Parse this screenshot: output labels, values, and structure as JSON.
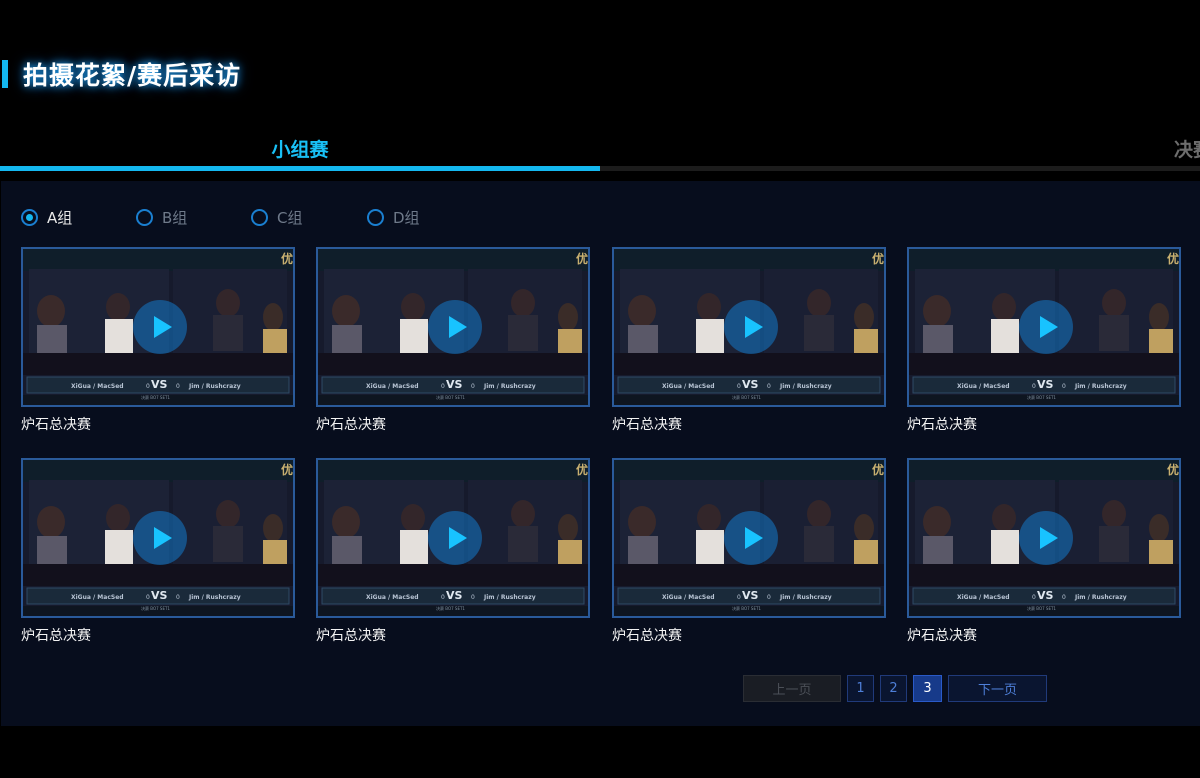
{
  "section": {
    "title": "拍摄花絮/赛后采访"
  },
  "tabs": [
    {
      "label": "小组赛",
      "active": true
    },
    {
      "label": "决赛",
      "active": false
    }
  ],
  "groups": [
    {
      "label": "A组",
      "selected": true
    },
    {
      "label": "B组",
      "selected": false
    },
    {
      "label": "C组",
      "selected": false
    },
    {
      "label": "D组",
      "selected": false
    }
  ],
  "videos": [
    {
      "title": "炉石总决赛",
      "team_left": "XiGua / MacSed",
      "team_right": "Jim / Rushcrazy",
      "score_left": "0",
      "score_right": "0",
      "vs": "VS",
      "stage": "决赛 BO7 SET1"
    },
    {
      "title": "炉石总决赛",
      "team_left": "XiGua / MacSed",
      "team_right": "Jim / Rushcrazy",
      "score_left": "0",
      "score_right": "0",
      "vs": "VS",
      "stage": "决赛 BO7 SET1"
    },
    {
      "title": "炉石总决赛",
      "team_left": "XiGua / MacSed",
      "team_right": "Jim / Rushcrazy",
      "score_left": "0",
      "score_right": "0",
      "vs": "VS",
      "stage": "决赛 BO7 SET1"
    },
    {
      "title": "炉石总决赛",
      "team_left": "XiGua / MacSed",
      "team_right": "Jim / Rushcrazy",
      "score_left": "0",
      "score_right": "0",
      "vs": "VS",
      "stage": "决赛 BO7 SET1"
    },
    {
      "title": "炉石总决赛",
      "team_left": "XiGua / MacSed",
      "team_right": "Jim / Rushcrazy",
      "score_left": "0",
      "score_right": "0",
      "vs": "VS",
      "stage": "决赛 BO7 SET1"
    },
    {
      "title": "炉石总决赛",
      "team_left": "XiGua / MacSed",
      "team_right": "Jim / Rushcrazy",
      "score_left": "0",
      "score_right": "0",
      "vs": "VS",
      "stage": "决赛 BO7 SET1"
    },
    {
      "title": "炉石总决赛",
      "team_left": "XiGua / MacSed",
      "team_right": "Jim / Rushcrazy",
      "score_left": "0",
      "score_right": "0",
      "vs": "VS",
      "stage": "决赛 BO7 SET1"
    },
    {
      "title": "炉石总决赛",
      "team_left": "XiGua / MacSed",
      "team_right": "Jim / Rushcrazy",
      "score_left": "0",
      "score_right": "0",
      "vs": "VS",
      "stage": "决赛 BO7 SET1"
    }
  ],
  "pagination": {
    "prev_label": "上一页",
    "next_label": "下一页",
    "pages": [
      "1",
      "2",
      "3"
    ],
    "current": "3"
  },
  "colors": {
    "accent": "#14b8f0",
    "panel": "#070d1d",
    "thumb_border": "#2a5a9a"
  },
  "icons": {
    "play": "play-icon",
    "radio_selected": "radio-selected-icon",
    "radio": "radio-icon"
  }
}
